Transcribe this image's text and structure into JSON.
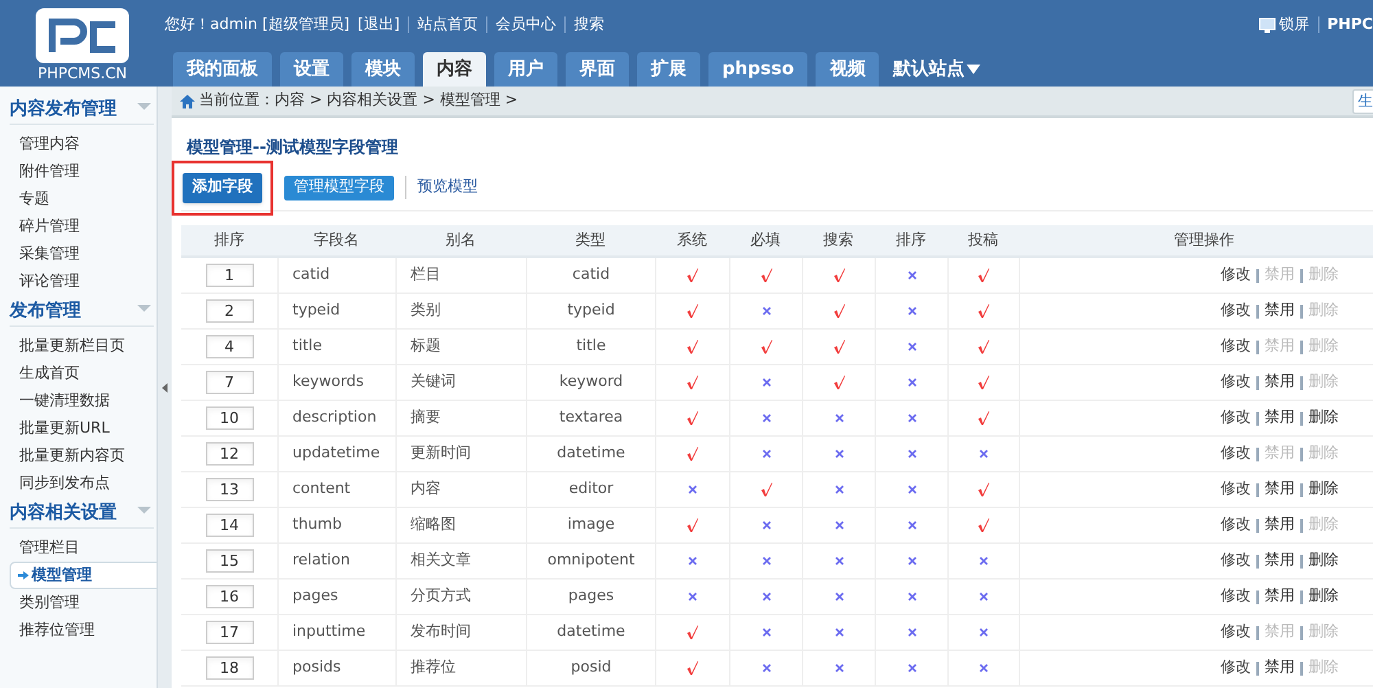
{
  "header": {
    "logo_text": "PHPCMS.CN",
    "greeting": "您好！admin [超级管理员]",
    "top_links": [
      "[退出]",
      "站点首页",
      "会员中心",
      "搜索"
    ],
    "lock": "锁屏",
    "brand_cut": "PHPC"
  },
  "nav_tabs": [
    {
      "label": "我的面板",
      "selected": false
    },
    {
      "label": "设置",
      "selected": false
    },
    {
      "label": "模块",
      "selected": false
    },
    {
      "label": "内容",
      "selected": true
    },
    {
      "label": "用户",
      "selected": false
    },
    {
      "label": "界面",
      "selected": false
    },
    {
      "label": "扩展",
      "selected": false
    },
    {
      "label": "phpsso",
      "selected": false
    },
    {
      "label": "视频",
      "selected": false
    }
  ],
  "site_menu": "默认站点",
  "sidebar": [
    {
      "title": "内容发布管理",
      "expanded": true,
      "items": [
        {
          "label": "管理内容",
          "selected": false
        },
        {
          "label": "附件管理",
          "selected": false
        },
        {
          "label": "专题",
          "selected": false
        },
        {
          "label": "碎片管理",
          "selected": false
        },
        {
          "label": "采集管理",
          "selected": false
        },
        {
          "label": "评论管理",
          "selected": false
        }
      ]
    },
    {
      "title": "发布管理",
      "expanded": true,
      "items": [
        {
          "label": "批量更新栏目页",
          "selected": false
        },
        {
          "label": "生成首页",
          "selected": false
        },
        {
          "label": "一键清理数据",
          "selected": false
        },
        {
          "label": "批量更新URL",
          "selected": false
        },
        {
          "label": "批量更新内容页",
          "selected": false
        },
        {
          "label": "同步到发布点",
          "selected": false
        }
      ]
    },
    {
      "title": "内容相关设置",
      "expanded": true,
      "items": [
        {
          "label": "管理栏目",
          "selected": false
        },
        {
          "label": "模型管理",
          "selected": true
        },
        {
          "label": "类别管理",
          "selected": false
        },
        {
          "label": "推荐位管理",
          "selected": false
        }
      ]
    }
  ],
  "breadcrumb": "当前位置：内容 > 内容相关设置 > 模型管理 >",
  "corner_button": "生",
  "page_title": "模型管理--测试模型字段管理",
  "actions": [
    {
      "label": "添加字段",
      "kind": "primary",
      "highlighted": true
    },
    {
      "label": "管理模型字段",
      "kind": "button",
      "highlighted": false
    },
    {
      "label": "预览模型",
      "kind": "link",
      "highlighted": false
    }
  ],
  "table": {
    "columns": [
      "排序",
      "字段名",
      "别名",
      "类型",
      "系统",
      "必填",
      "搜索",
      "排序",
      "投稿",
      "管理操作"
    ],
    "rows": [
      {
        "order": "1",
        "field": "catid",
        "alias": "栏目",
        "type": "catid",
        "system": true,
        "required": true,
        "search": true,
        "sort": false,
        "contribute": true,
        "edit": "修改",
        "disable": "禁用",
        "disable_enabled": false,
        "delete": "删除",
        "delete_enabled": false
      },
      {
        "order": "2",
        "field": "typeid",
        "alias": "类别",
        "type": "typeid",
        "system": true,
        "required": false,
        "search": true,
        "sort": false,
        "contribute": true,
        "edit": "修改",
        "disable": "禁用",
        "disable_enabled": true,
        "delete": "删除",
        "delete_enabled": false
      },
      {
        "order": "4",
        "field": "title",
        "alias": "标题",
        "type": "title",
        "system": true,
        "required": true,
        "search": true,
        "sort": false,
        "contribute": true,
        "edit": "修改",
        "disable": "禁用",
        "disable_enabled": false,
        "delete": "删除",
        "delete_enabled": false
      },
      {
        "order": "7",
        "field": "keywords",
        "alias": "关键词",
        "type": "keyword",
        "system": true,
        "required": false,
        "search": true,
        "sort": false,
        "contribute": true,
        "edit": "修改",
        "disable": "禁用",
        "disable_enabled": true,
        "delete": "删除",
        "delete_enabled": false
      },
      {
        "order": "10",
        "field": "description",
        "alias": "摘要",
        "type": "textarea",
        "system": true,
        "required": false,
        "search": false,
        "sort": false,
        "contribute": true,
        "edit": "修改",
        "disable": "禁用",
        "disable_enabled": true,
        "delete": "删除",
        "delete_enabled": true
      },
      {
        "order": "12",
        "field": "updatetime",
        "alias": "更新时间",
        "type": "datetime",
        "system": true,
        "required": false,
        "search": false,
        "sort": false,
        "contribute": false,
        "edit": "修改",
        "disable": "禁用",
        "disable_enabled": false,
        "delete": "删除",
        "delete_enabled": false
      },
      {
        "order": "13",
        "field": "content",
        "alias": "内容",
        "type": "editor",
        "system": false,
        "required": true,
        "search": false,
        "sort": false,
        "contribute": true,
        "edit": "修改",
        "disable": "禁用",
        "disable_enabled": true,
        "delete": "删除",
        "delete_enabled": true
      },
      {
        "order": "14",
        "field": "thumb",
        "alias": "缩略图",
        "type": "image",
        "system": true,
        "required": false,
        "search": false,
        "sort": false,
        "contribute": true,
        "edit": "修改",
        "disable": "禁用",
        "disable_enabled": true,
        "delete": "删除",
        "delete_enabled": false
      },
      {
        "order": "15",
        "field": "relation",
        "alias": "相关文章",
        "type": "omnipotent",
        "system": false,
        "required": false,
        "search": false,
        "sort": false,
        "contribute": false,
        "edit": "修改",
        "disable": "禁用",
        "disable_enabled": true,
        "delete": "删除",
        "delete_enabled": true
      },
      {
        "order": "16",
        "field": "pages",
        "alias": "分页方式",
        "type": "pages",
        "system": false,
        "required": false,
        "search": false,
        "sort": false,
        "contribute": false,
        "edit": "修改",
        "disable": "禁用",
        "disable_enabled": true,
        "delete": "删除",
        "delete_enabled": true
      },
      {
        "order": "17",
        "field": "inputtime",
        "alias": "发布时间",
        "type": "datetime",
        "system": true,
        "required": false,
        "search": false,
        "sort": false,
        "contribute": false,
        "edit": "修改",
        "disable": "禁用",
        "disable_enabled": false,
        "delete": "删除",
        "delete_enabled": false
      },
      {
        "order": "18",
        "field": "posids",
        "alias": "推荐位",
        "type": "posid",
        "system": true,
        "required": false,
        "search": false,
        "sort": false,
        "contribute": false,
        "edit": "修改",
        "disable": "禁用",
        "disable_enabled": true,
        "delete": "删除",
        "delete_enabled": false
      }
    ]
  }
}
